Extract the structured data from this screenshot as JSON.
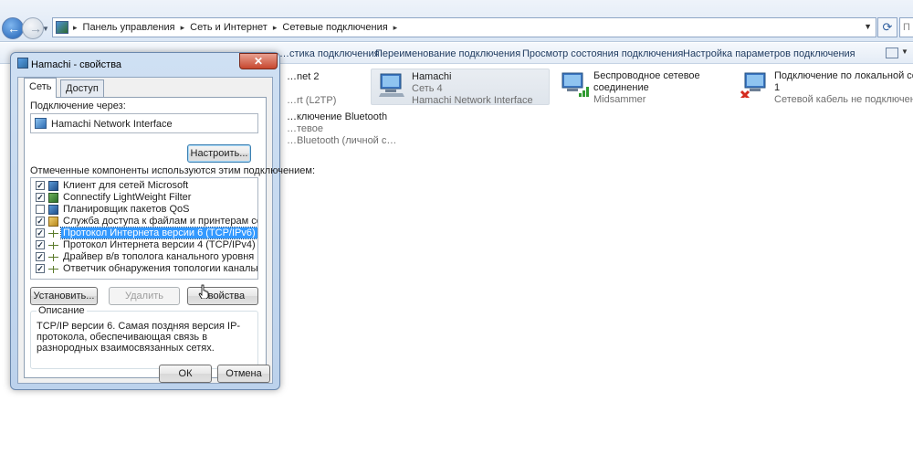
{
  "explorer": {
    "breadcrumbs": [
      "Панель управления",
      "Сеть и Интернет",
      "Сетевые подключения"
    ],
    "search_placeholder": "П",
    "refresh_icon": "refresh-icon"
  },
  "commandbar": {
    "items": [
      "…стика подключения",
      "Переименование подключения",
      "Просмотр состояния подключения",
      "Настройка параметров подключения"
    ]
  },
  "connections": [
    {
      "name": "…net 2",
      "line2": "",
      "line3": "…rt (L2TP)"
    },
    {
      "name": "Hamachi",
      "line2": "Сеть 4",
      "line3": "Hamachi Network Interface"
    },
    {
      "name": "Беспроводное сетевое",
      "line2": "соединение",
      "line3": "Midsammer"
    },
    {
      "name": "Подключение по локальной сети",
      "line2": "1",
      "line3": "Сетевой кабель не подключен"
    },
    {
      "name": "…ключение Bluetooth",
      "line2": "…тевое",
      "line3": "…Bluetooth (личной с…"
    }
  ],
  "dialog": {
    "title": "Hamachi - свойства",
    "close_label": "✕",
    "tabs": [
      "Сеть",
      "Доступ"
    ],
    "connect_using_label": "Подключение через:",
    "adapter_name": "Hamachi Network Interface",
    "configure_button": "Настроить...",
    "components_label": "Отмеченные компоненты используются этим подключением:",
    "components": [
      {
        "label": "Клиент для сетей Microsoft",
        "checked": true,
        "icon": "client"
      },
      {
        "label": "Connectify LightWeight Filter",
        "checked": true,
        "icon": "filter"
      },
      {
        "label": "Планировщик пакетов QoS",
        "checked": false,
        "icon": "qos"
      },
      {
        "label": "Служба доступа к файлам и принтерам сетей Micro...",
        "checked": true,
        "icon": "share"
      },
      {
        "label": "Протокол Интернета версии 6 (TCP/IPv6)",
        "checked": true,
        "icon": "proto",
        "selected": true
      },
      {
        "label": "Протокол Интернета версии 4 (TCP/IPv4)",
        "checked": true,
        "icon": "proto"
      },
      {
        "label": "Драйвер в/в тополога канального уровня",
        "checked": true,
        "icon": "proto"
      },
      {
        "label": "Ответчик обнаружения топологии канального уровня",
        "checked": true,
        "icon": "proto"
      }
    ],
    "install_button": "Установить...",
    "remove_button": "Удалить",
    "properties_button": "Свойства",
    "description_legend": "Описание",
    "description_text": "TCP/IP версии 6. Самая поздняя версия IP-протокола, обеспечивающая связь в разнородных взаимосвязанных сетях.",
    "ok_button": "ОК",
    "cancel_button": "Отмена"
  }
}
